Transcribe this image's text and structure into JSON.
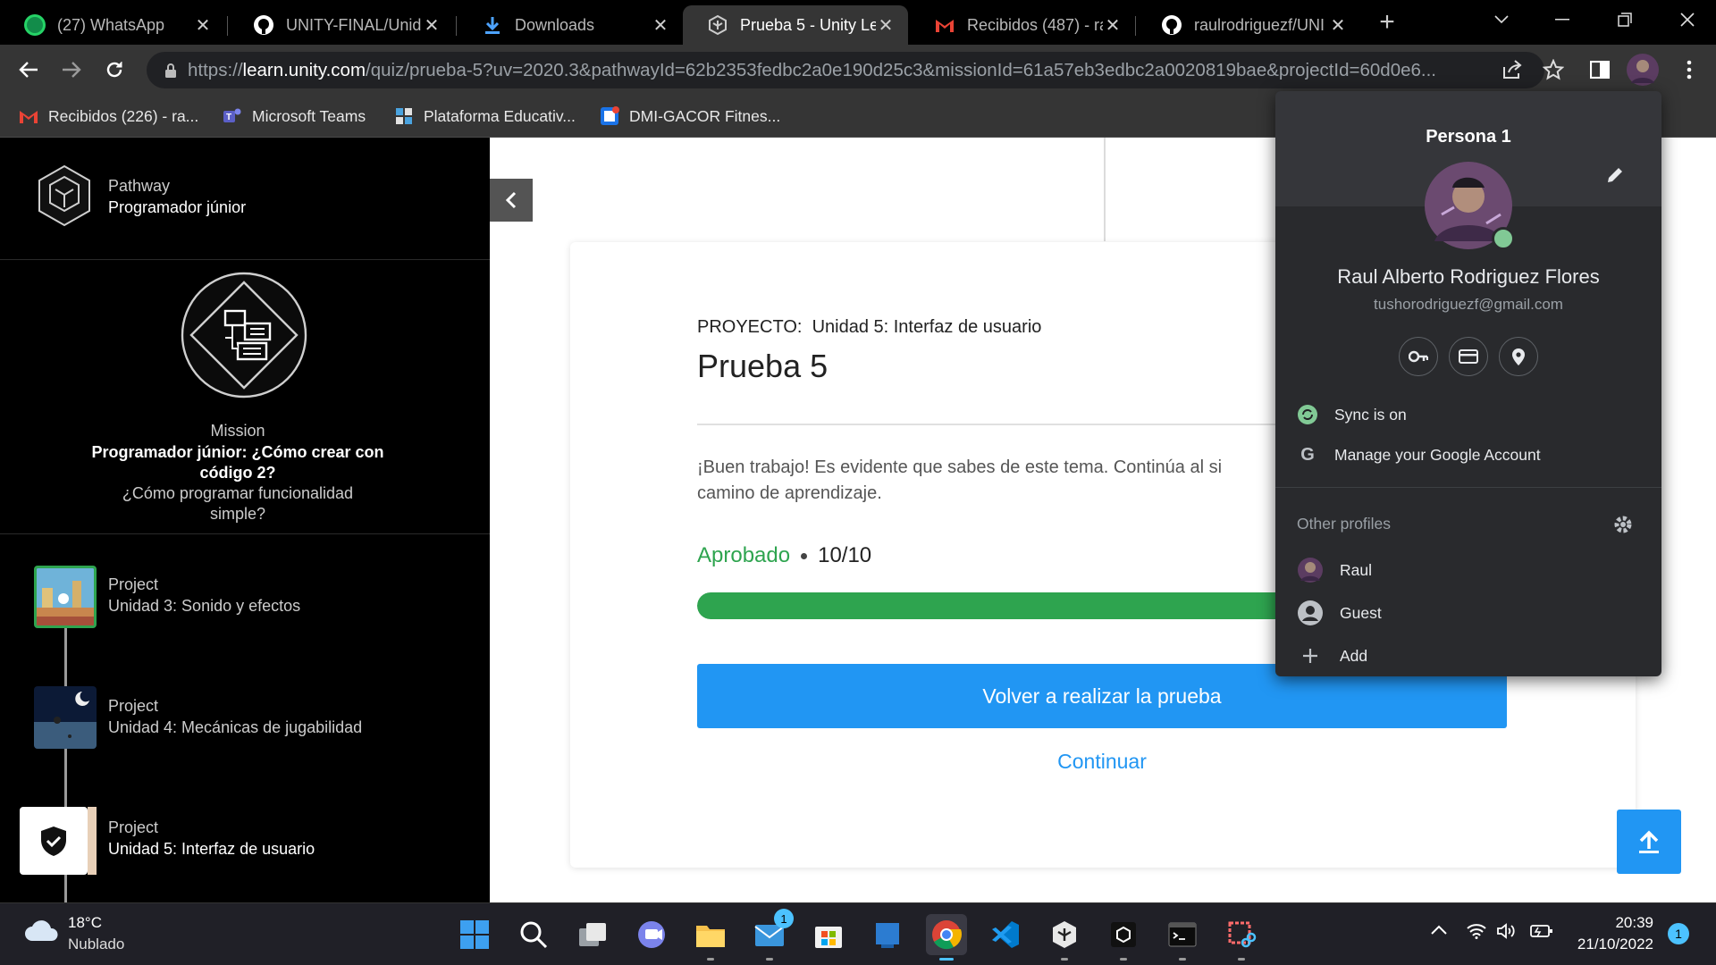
{
  "tabs": [
    {
      "label": "(27) WhatsApp",
      "icon": "whatsapp-icon",
      "badge": "27",
      "active": false
    },
    {
      "label": "UNITY-FINAL/Unid",
      "icon": "github-icon",
      "active": false
    },
    {
      "label": "Downloads",
      "icon": "download-icon",
      "active": false
    },
    {
      "label": "Prueba 5 - Unity Le",
      "icon": "unity-icon",
      "active": true
    },
    {
      "label": "Recibidos (487) - ra",
      "icon": "gmail-icon",
      "active": false
    },
    {
      "label": "raulrodriguezf/UNI",
      "icon": "github-icon",
      "active": false
    }
  ],
  "address_bar": {
    "scheme": "https://",
    "domain": "learn.unity.com",
    "path": "/quiz/prueba-5?uv=2020.3&pathwayId=62b2353fedbc2a0e190d25c3&missionId=61a57eb3edbc2a0020819bae&projectId=60d0e6..."
  },
  "bookmarks": [
    {
      "label": "Recibidos (226) - ra...",
      "icon": "gmail-icon"
    },
    {
      "label": "Microsoft Teams",
      "icon": "teams-icon"
    },
    {
      "label": "Plataforma Educativ...",
      "icon": "edu-platform-icon"
    },
    {
      "label": "DMI-GACOR Fitnes...",
      "icon": "fitness-icon"
    }
  ],
  "sidebar": {
    "pathway_label": "Pathway",
    "pathway_name": "Programador júnior",
    "mission_label": "Mission",
    "mission_title": "Programador júnior: ¿Cómo crear con código 2?",
    "mission_subtitle": "¿Cómo programar funcionalidad simple?",
    "projects": [
      {
        "kind": "Project",
        "name": "Unidad 3: Sonido y efectos",
        "state": "completed"
      },
      {
        "kind": "Project",
        "name": "Unidad 4: Mecánicas de jugabilidad",
        "state": "default"
      },
      {
        "kind": "Project",
        "name": "Unidad 5: Interfaz de usuario",
        "state": "current"
      }
    ]
  },
  "quiz": {
    "project_prefix": "PROYECTO:",
    "project_name": "Unidad 5: Interfaz de usuario",
    "title": "Prueba 5",
    "message_line1": "¡Buen trabajo! Es evidente que sabes de este tema. Continúa al si",
    "message_line2": "camino de aprendizaje.",
    "result_label": "Aprobado",
    "score": "10/10",
    "progress_fraction": 1.0,
    "retry_button": "Volver a realizar la prueba",
    "continue_link": "Continuar"
  },
  "profile_menu": {
    "profile_name": "Persona 1",
    "user_name": "Raul Alberto Rodriguez Flores",
    "email": "tushorodriguezf@gmail.com",
    "sync_label": "Sync is on",
    "manage_account": "Manage your Google Account",
    "other_profiles_label": "Other profiles",
    "profiles": [
      "Raul",
      "Guest"
    ],
    "add_label": "Add"
  },
  "taskbar": {
    "weather_temp": "18°C",
    "weather_desc": "Nublado",
    "mail_badge": "1",
    "time": "20:39",
    "date": "21/10/2022",
    "notification_count": "1"
  },
  "colors": {
    "accent_blue": "#2196f3",
    "success_green": "#2ea44f",
    "chrome_bg": "#353535",
    "popup_bg": "#292a2d"
  }
}
